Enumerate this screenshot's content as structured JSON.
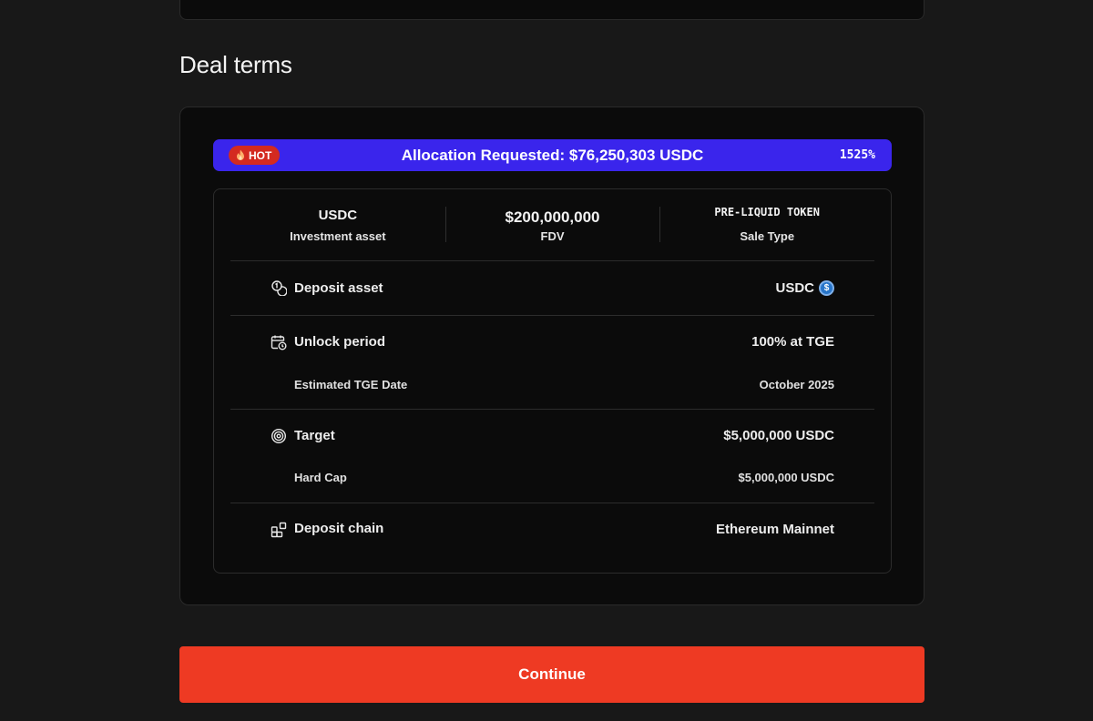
{
  "section": {
    "title": "Deal terms"
  },
  "allocation": {
    "badge": "HOT",
    "text": "Allocation Requested: $76,250,303 USDC",
    "percent": "1525%"
  },
  "stats": [
    {
      "value": "USDC",
      "label": "Investment asset"
    },
    {
      "value": "$200,000,000",
      "label": "FDV"
    },
    {
      "value": "PRE-LIQUID TOKEN",
      "label": "Sale Type"
    }
  ],
  "rows": {
    "deposit_asset": {
      "label": "Deposit asset",
      "value": "USDC",
      "icon": "coins-icon"
    },
    "unlock_period": {
      "label": "Unlock period",
      "value": "100% at TGE",
      "icon": "calendar-clock-icon",
      "sub": {
        "label": "Estimated TGE Date",
        "value": "October 2025"
      }
    },
    "target": {
      "label": "Target",
      "value": "$5,000,000 USDC",
      "icon": "target-icon",
      "sub": {
        "label": "Hard Cap",
        "value": "$5,000,000 USDC"
      }
    },
    "deposit_chain": {
      "label": "Deposit chain",
      "value": "Ethereum Mainnet",
      "icon": "blocks-icon"
    }
  },
  "colors": {
    "accent_bar": "#3a25ec",
    "hot_badge": "#d42a20",
    "continue_button": "#ee3a23",
    "usdc_coin": "#2775ca"
  },
  "actions": {
    "continue_label": "Continue"
  }
}
